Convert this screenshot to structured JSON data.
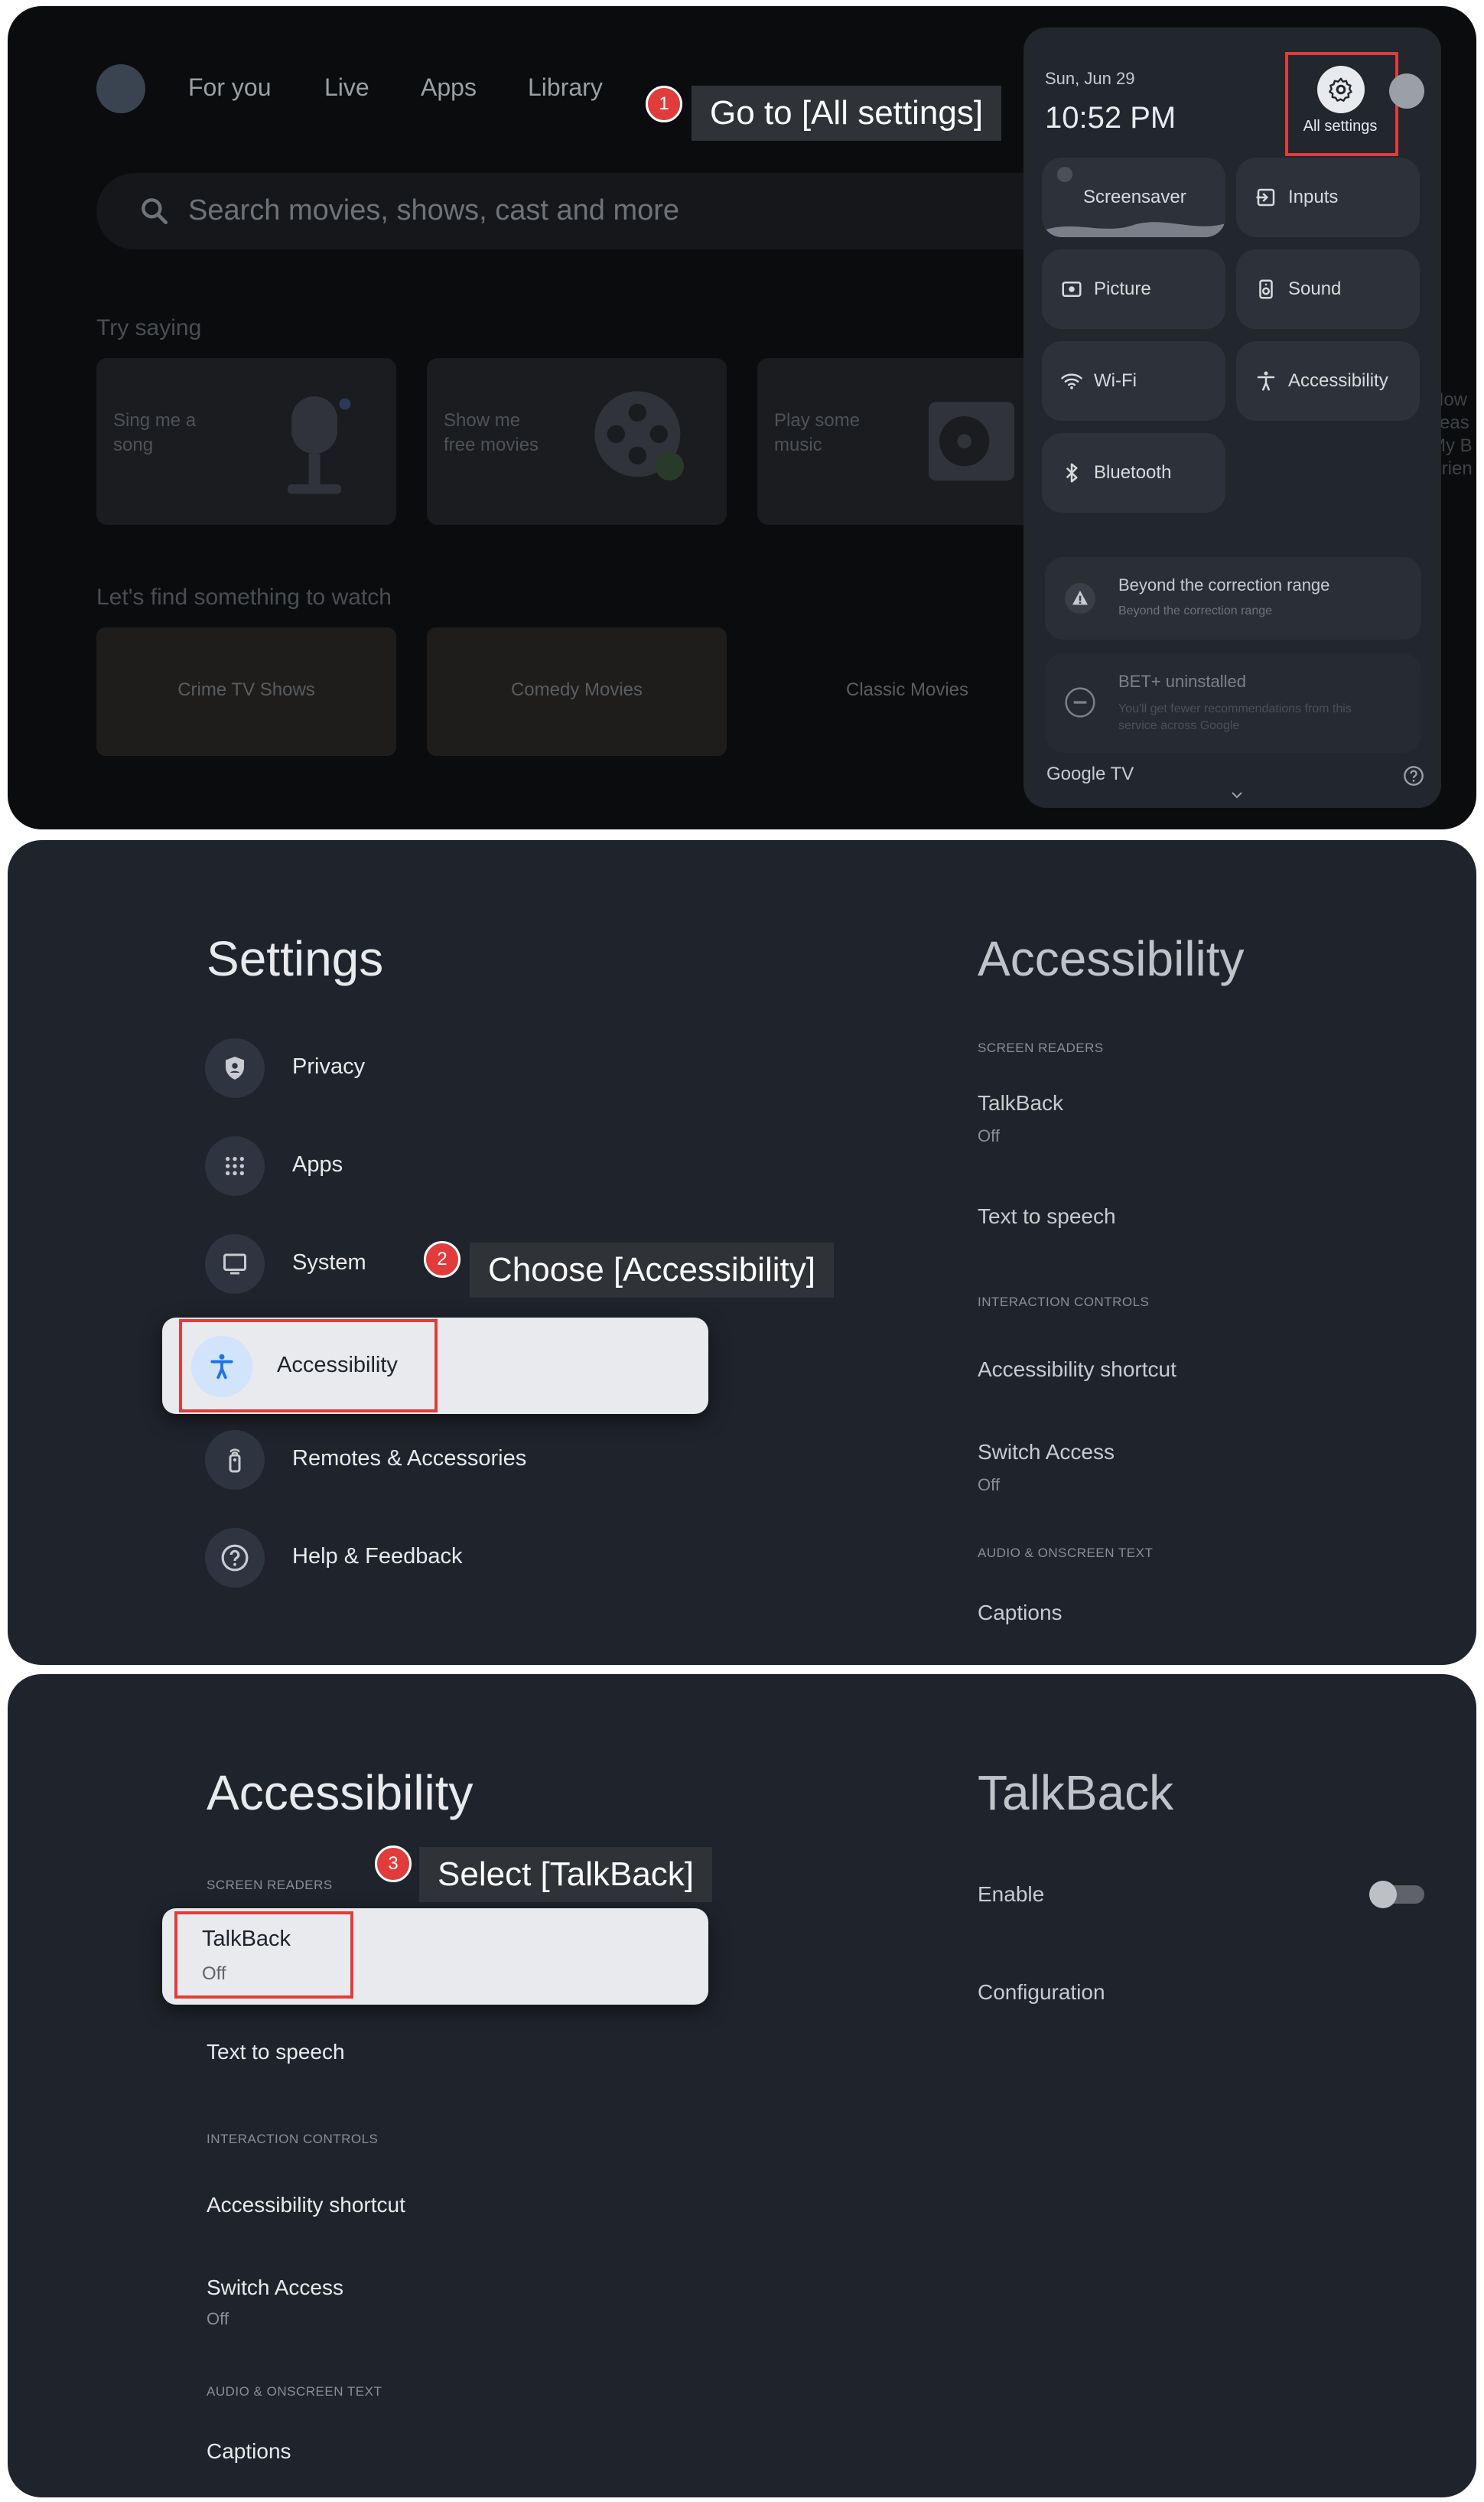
{
  "panel1": {
    "nav": [
      "For you",
      "Live",
      "Apps",
      "Library"
    ],
    "search_placeholder": "Search movies, shows, cast and more",
    "try_saying": "Try saying",
    "suggestions": [
      {
        "line1": "Sing me a",
        "line2": "song"
      },
      {
        "line1": "Show me",
        "line2": "free movies"
      },
      {
        "line1": "Play some",
        "line2": "music"
      }
    ],
    "peek_text": [
      "How",
      "seas",
      "My B",
      "Frien"
    ],
    "lets_find": "Let's find something to watch",
    "movies": [
      "Crime TV Shows",
      "Comedy Movies",
      "Classic Movies"
    ],
    "callout": {
      "num": "1",
      "text": "Go to [All settings]"
    },
    "quick_settings": {
      "date": "Sun, Jun 29",
      "time": "10:52 PM",
      "all_settings": "All settings",
      "tiles": [
        "Screensaver",
        "Inputs",
        "Picture",
        "Sound",
        "Wi-Fi",
        "Accessibility",
        "Bluetooth"
      ],
      "notifications": [
        {
          "title": "Beyond the correction range",
          "sub": "Beyond the correction range"
        },
        {
          "title": "BET+ uninstalled",
          "sub": "You'll get fewer recommendations from this",
          "sub2": "service across Google"
        }
      ],
      "footer": "Google TV"
    }
  },
  "panel2": {
    "title": "Settings",
    "menu": [
      "Privacy",
      "Apps",
      "System",
      "Accessibility",
      "Remotes & Accessories",
      "Help & Feedback"
    ],
    "callout": {
      "num": "2",
      "text": "Choose [Accessibility]"
    },
    "right": {
      "title": "Accessibility",
      "cat_screen_readers": "SCREEN READERS",
      "talkback": "TalkBack",
      "talkback_state": "Off",
      "tts": "Text to speech",
      "cat_interaction": "INTERACTION CONTROLS",
      "shortcut": "Accessibility shortcut",
      "switch_access": "Switch Access",
      "switch_state": "Off",
      "cat_audio": "AUDIO & ONSCREEN TEXT",
      "captions": "Captions"
    }
  },
  "panel3": {
    "title": "Accessibility",
    "cat_screen_readers": "SCREEN READERS",
    "talkback": "TalkBack",
    "talkback_state": "Off",
    "tts": "Text to speech",
    "cat_interaction": "INTERACTION CONTROLS",
    "shortcut": "Accessibility shortcut",
    "switch_access": "Switch Access",
    "switch_state": "Off",
    "cat_audio": "AUDIO & ONSCREEN TEXT",
    "captions": "Captions",
    "callout": {
      "num": "3",
      "text": "Select [TalkBack]"
    },
    "right": {
      "title": "TalkBack",
      "enable": "Enable",
      "configuration": "Configuration"
    }
  },
  "colors": {
    "accent_red": "#e23b3b",
    "panel_bg": "#1f232b",
    "selected_row": "#e8eaed"
  }
}
